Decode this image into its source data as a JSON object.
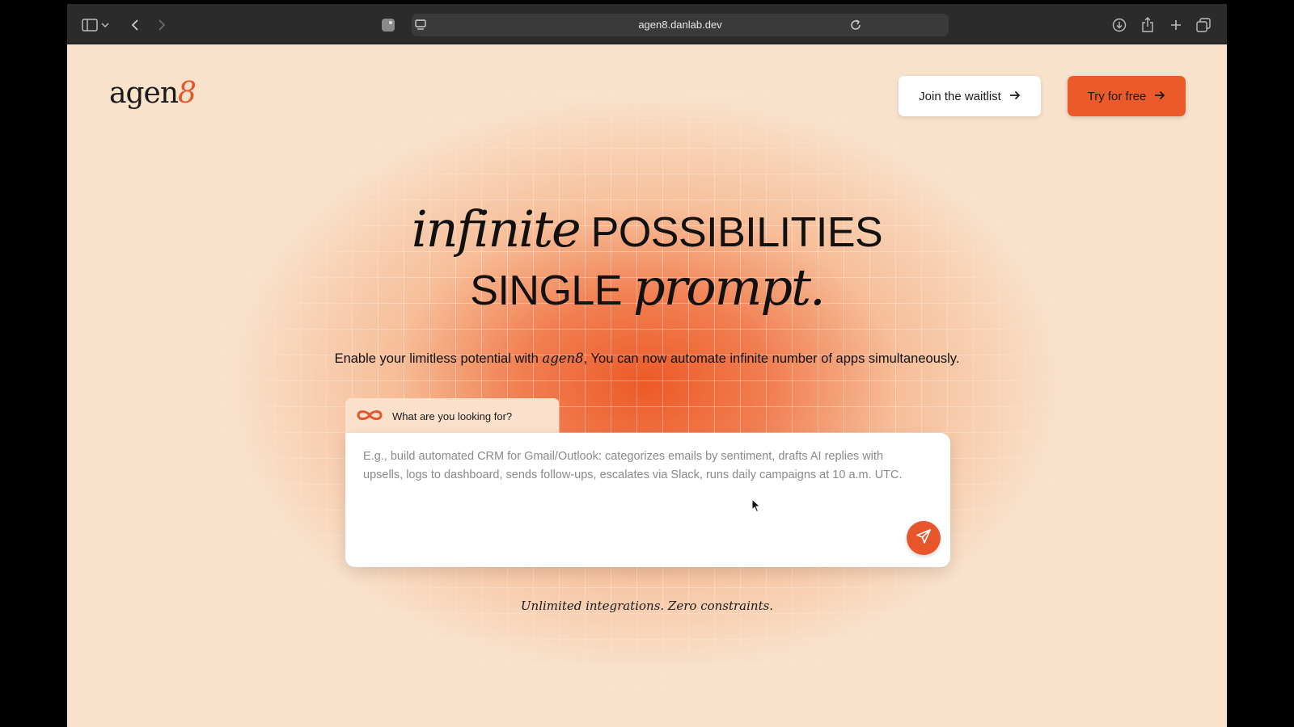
{
  "browser": {
    "url": "agen8.danlab.dev",
    "icons": [
      "sidebar-icon",
      "chevron-down-icon",
      "back-icon",
      "forward-icon",
      "extension-icon",
      "reader-icon",
      "reload-icon",
      "download-icon",
      "share-icon",
      "new-tab-icon",
      "tabs-overview-icon"
    ]
  },
  "header": {
    "logo_text": "agen",
    "logo_accent": "8",
    "waitlist_label": "Join the waitlist",
    "try_label": "Try for free"
  },
  "hero": {
    "line1_serif": "infinite",
    "line1_sans": " POSSIBILITIES",
    "line2_sans": "SINGLE ",
    "line2_serif": "prompt.",
    "subtitle_before": "Enable your limitless potential with ",
    "subtitle_brand": "agen8",
    "subtitle_after": ", You can now automate infinite number of apps simultaneously."
  },
  "prompt": {
    "tab_label": "What are you looking for?",
    "placeholder": "E.g., build automated CRM for Gmail/Outlook: categorizes emails by sentiment, drafts AI replies with upsells, logs to dashboard, sends follow-ups, escalates via Slack, runs daily campaigns at 10 a.m. UTC.",
    "value": ""
  },
  "tagline": "Unlimited integrations. Zero constraints.",
  "colors": {
    "accent": "#e6562a",
    "background": "#f8e2cc",
    "toolbar": "#2b2b2b"
  }
}
